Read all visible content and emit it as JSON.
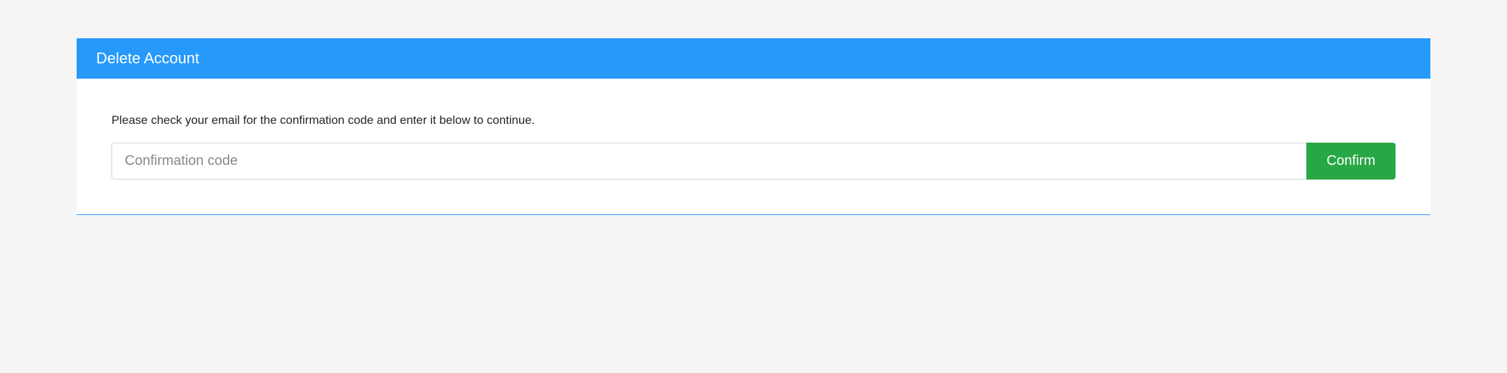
{
  "panel": {
    "title": "Delete Account",
    "instruction": "Please check your email for the confirmation code and enter it below to continue.",
    "input_placeholder": "Confirmation code",
    "input_value": "",
    "confirm_label": "Confirm"
  }
}
